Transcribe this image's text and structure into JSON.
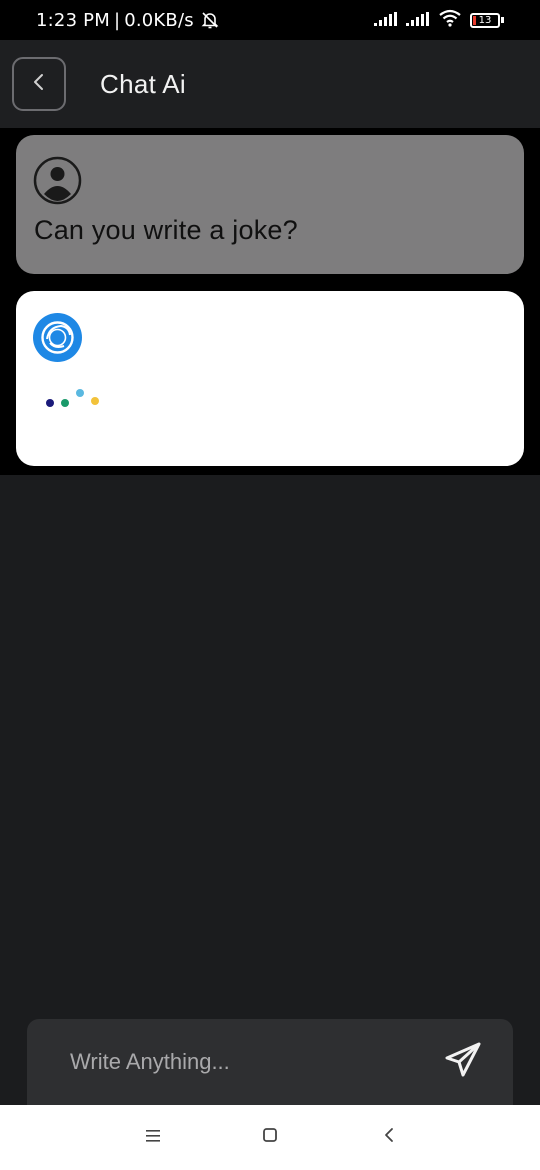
{
  "status_bar": {
    "time": "1:23 PM",
    "separator": "|",
    "network_speed": "0.0KB/s",
    "battery_level": "13",
    "icons": [
      "muted-bell-icon",
      "signal-icon",
      "signal-icon",
      "wifi-icon",
      "battery-icon"
    ]
  },
  "header": {
    "title": "Chat Ai",
    "back_icon": "chevron-left-icon"
  },
  "chat": {
    "messages": [
      {
        "sender": "user",
        "avatar": "user-avatar-icon",
        "text": "Can you write a joke?"
      },
      {
        "sender": "ai",
        "avatar": "ai-logo-icon",
        "state": "typing"
      }
    ],
    "typing_dot_colors": [
      "#1a1a7a",
      "#1a9a6a",
      "#5ab8e0",
      "#f2c23a"
    ]
  },
  "composer": {
    "placeholder": "Write Anything...",
    "send_icon": "send-icon"
  },
  "nav_bar": {
    "icons": [
      "menu-icon",
      "home-icon",
      "back-icon"
    ]
  },
  "colors": {
    "background": "#1b1c1e",
    "user_bubble": "#7e7d7e",
    "ai_bubble": "#ffffff",
    "ai_accent": "#1e88e5"
  }
}
